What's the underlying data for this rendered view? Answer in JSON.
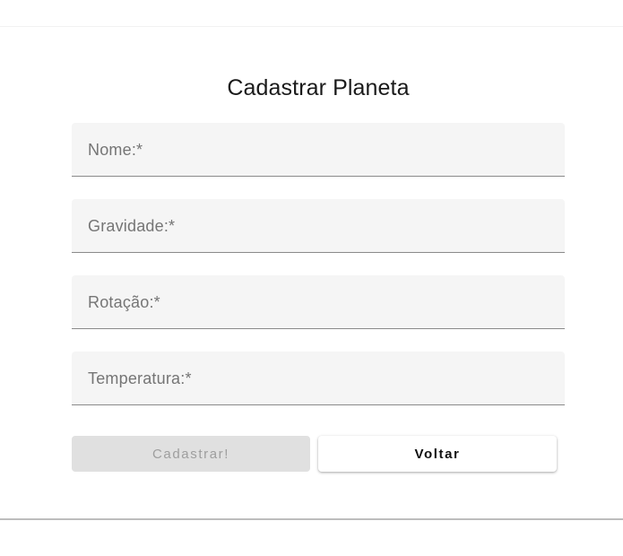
{
  "form": {
    "title": "Cadastrar Planeta",
    "fields": [
      {
        "label": "Nome:*",
        "value": ""
      },
      {
        "label": "Gravidade:*",
        "value": ""
      },
      {
        "label": "Rotação:*",
        "value": ""
      },
      {
        "label": "Temperatura:*",
        "value": ""
      }
    ],
    "submit_label": "Cadastrar!",
    "back_label": "Voltar"
  },
  "colors": {
    "field_background": "#f5f5f5",
    "submit_disabled_background": "#e0e0e0",
    "submit_disabled_text": "#9e9e9e"
  }
}
